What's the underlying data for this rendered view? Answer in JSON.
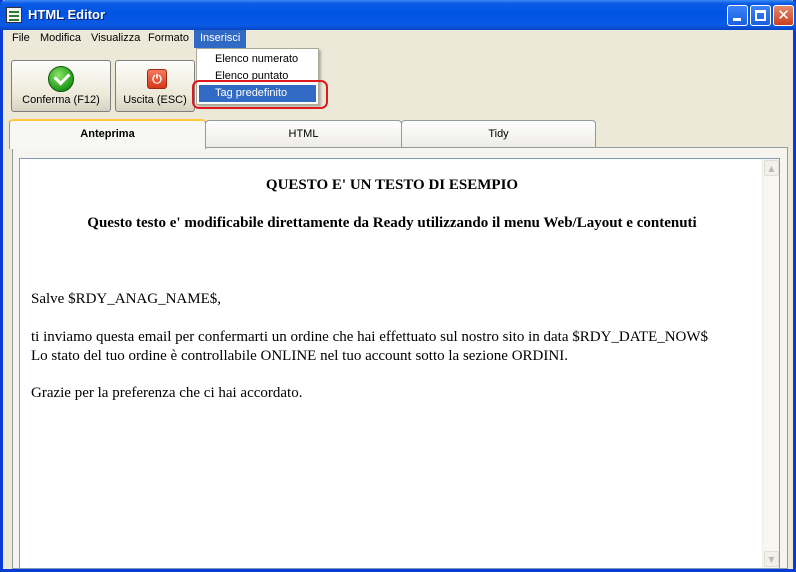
{
  "window": {
    "title": "HTML Editor",
    "close_glyph": "✕"
  },
  "menubar": {
    "items": [
      "File",
      "Modifica",
      "Visualizza",
      "Formato",
      "Inserisci"
    ],
    "active": "Inserisci"
  },
  "dropdown": {
    "items": [
      "Elenco numerato",
      "Elenco puntato",
      "Tag predefinito"
    ],
    "selected": "Tag predefinito"
  },
  "toolbar": {
    "confirm_label": "Conferma (F12)",
    "confirm_icon": "check-circle-icon",
    "exit_label": "Uscita (ESC)",
    "exit_icon": "power-icon",
    "exit_glyph": "⏻"
  },
  "tabs": {
    "items": [
      "Anteprima",
      "HTML",
      "Tidy"
    ],
    "active": "Anteprima"
  },
  "document": {
    "heading": "QUESTO E' UN TESTO DI ESEMPIO",
    "subheading": "Questo testo e' modificabile direttamente da Ready utilizzando il menu Web/Layout e contenuti",
    "greeting": "Salve $RDY_ANAG_NAME$,",
    "line1": "ti inviamo questa email per confermarti un ordine che hai effettuato sul nostro sito in data $RDY_DATE_NOW$",
    "line2": "Lo stato del tuo ordine è controllabile ONLINE nel tuo account sotto la sezione ORDINI.",
    "thanks": "Grazie per la preferenza che ci hai accordato."
  },
  "colors": {
    "title_bar": "#0054e3",
    "menu_highlight": "#316ac5",
    "annotation_ring": "#e0191f",
    "active_tab_accent": "#ffc83c"
  }
}
